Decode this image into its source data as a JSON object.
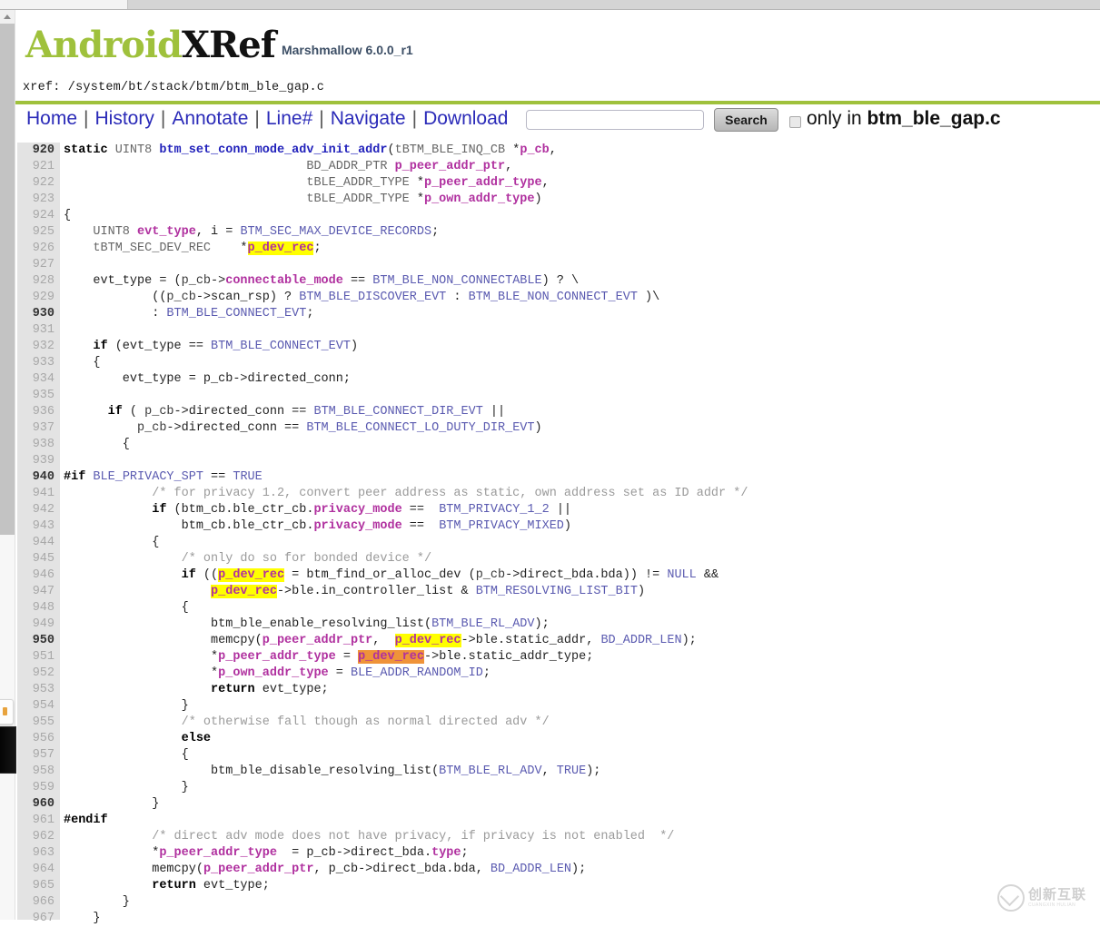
{
  "browser": {
    "tab_label": ""
  },
  "header": {
    "logo_android": "Android",
    "logo_xref": "XRef",
    "version": "Marshmallow 6.0.0_r1",
    "xref_path": "xref: /system/bt/stack/btm/btm_ble_gap.c"
  },
  "nav": {
    "links": [
      "Home",
      "History",
      "Annotate",
      "Line#",
      "Navigate",
      "Download"
    ],
    "separator": "|",
    "search_value": "",
    "search_placeholder": "",
    "search_button": "Search",
    "only_in_prefix": "only in ",
    "only_in_file": "btm_ble_gap.c",
    "only_in_checked": false
  },
  "colors": {
    "brand_green": "#9fc13c",
    "link_blue": "#2a2ab8",
    "gutter_bg": "#e3e3e3",
    "highlight_yellow": "#ffff00",
    "highlight_orange": "#ef9339",
    "var_magenta": "#b0309f",
    "fn_blue": "#2222bb",
    "const_blue": "#5a5ab0",
    "comment_gray": "#9a9a9a"
  },
  "watermark": {
    "cn": "创新互联",
    "en": "CUANGXIN HULIAN"
  },
  "code": {
    "first_line": 920,
    "last_line": 967,
    "lines": [
      {
        "n": 920,
        "html": "<span class=\"kw\">static</span> <span class=\"typ\">UINT8</span> <span class=\"fn\">btm_set_conn_mode_adv_init_addr</span>(<span class=\"typ\">tBTM_BLE_INQ_CB</span> *<span class=\"var\">p_cb</span>,"
      },
      {
        "n": 921,
        "html": "                                 <span class=\"typ\">BD_ADDR_PTR</span> <span class=\"var\">p_peer_addr_ptr</span>,"
      },
      {
        "n": 922,
        "html": "                                 <span class=\"typ\">tBLE_ADDR_TYPE</span> *<span class=\"var\">p_peer_addr_type</span>,"
      },
      {
        "n": 923,
        "html": "                                 <span class=\"typ\">tBLE_ADDR_TYPE</span> *<span class=\"var\">p_own_addr_type</span>)"
      },
      {
        "n": 924,
        "html": "{"
      },
      {
        "n": 925,
        "html": "    <span class=\"typ\">UINT8</span> <span class=\"var\">evt_type</span>, i = <span class=\"cnst\">BTM_SEC_MAX_DEVICE_RECORDS</span>;"
      },
      {
        "n": 926,
        "html": "    <span class=\"typ\">tBTM_SEC_DEV_REC</span>    *<span class=\"hl\"><span class=\"var\">p_dev_rec</span></span>;"
      },
      {
        "n": 927,
        "html": ""
      },
      {
        "n": 928,
        "html": "    evt_type = (<span class=\"plain\">p_cb</span>-&gt;<span class=\"var\">connectable_mode</span> == <span class=\"cnst\">BTM_BLE_NON_CONNECTABLE</span>) ? \\"
      },
      {
        "n": 929,
        "html": "            ((<span class=\"plain\">p_cb</span>-&gt;scan_rsp) ? <span class=\"cnst\">BTM_BLE_DISCOVER_EVT</span> : <span class=\"cnst\">BTM_BLE_NON_CONNECT_EVT</span> )\\"
      },
      {
        "n": 930,
        "html": "            : <span class=\"cnst\">BTM_BLE_CONNECT_EVT</span>;"
      },
      {
        "n": 931,
        "html": ""
      },
      {
        "n": 932,
        "html": "    <span class=\"kw\">if</span> (evt_type == <span class=\"cnst\">BTM_BLE_CONNECT_EVT</span>)"
      },
      {
        "n": 933,
        "html": "    {"
      },
      {
        "n": 934,
        "html": "        evt_type = p_cb-&gt;directed_conn;"
      },
      {
        "n": 935,
        "html": ""
      },
      {
        "n": 936,
        "html": "      <span class=\"kw\">if</span> ( <span class=\"plain\">p_cb</span>-&gt;directed_conn == <span class=\"cnst\">BTM_BLE_CONNECT_DIR_EVT</span> ||"
      },
      {
        "n": 937,
        "html": "          <span class=\"plain\">p_cb</span>-&gt;directed_conn == <span class=\"cnst\">BTM_BLE_CONNECT_LO_DUTY_DIR_EVT</span>)"
      },
      {
        "n": 938,
        "html": "        {"
      },
      {
        "n": 939,
        "html": ""
      },
      {
        "n": 940,
        "html": "<span class=\"pp\">#if</span> <span class=\"cnst\">BLE_PRIVACY_SPT</span> == <span class=\"cnst\">TRUE</span>"
      },
      {
        "n": 941,
        "html": "            <span class=\"cmt\">/* for privacy 1.2, convert peer address as static, own address set as ID addr */</span>"
      },
      {
        "n": 942,
        "html": "            <span class=\"kw\">if</span> (btm_cb.ble_ctr_cb.<span class=\"var\">privacy_mode</span> ==  <span class=\"cnst\">BTM_PRIVACY_1_2</span> ||"
      },
      {
        "n": 943,
        "html": "                btm_cb.ble_ctr_cb.<span class=\"var\">privacy_mode</span> ==  <span class=\"cnst\">BTM_PRIVACY_MIXED</span>)"
      },
      {
        "n": 944,
        "html": "            {"
      },
      {
        "n": 945,
        "html": "                <span class=\"cmt\">/* only do so for bonded device */</span>"
      },
      {
        "n": 946,
        "html": "                <span class=\"kw\">if</span> ((<span class=\"hl\"><span class=\"var\">p_dev_rec</span></span> = btm_find_or_alloc_dev (<span class=\"plain\">p_cb</span>-&gt;direct_bda.bda)) != <span class=\"cnst\">NULL</span> &amp;&amp;"
      },
      {
        "n": 947,
        "html": "                    <span class=\"hl\"><span class=\"var\">p_dev_rec</span></span>-&gt;ble.in_controller_list &amp; <span class=\"cnst\">BTM_RESOLVING_LIST_BIT</span>)"
      },
      {
        "n": 948,
        "html": "                {"
      },
      {
        "n": 949,
        "html": "                    btm_ble_enable_resolving_list(<span class=\"cnst\">BTM_BLE_RL_ADV</span>);"
      },
      {
        "n": 950,
        "html": "                    memcpy(<span class=\"var\">p_peer_addr_ptr</span>,  <span class=\"hl\"><span class=\"var\">p_dev_rec</span></span>-&gt;ble.static_addr, <span class=\"cnst\">BD_ADDR_LEN</span>);"
      },
      {
        "n": 951,
        "html": "                    *<span class=\"var\">p_peer_addr_type</span> = <span class=\"hl2\"><span class=\"var\">p_dev_rec</span></span>-&gt;ble.static_addr_type;"
      },
      {
        "n": 952,
        "html": "                    *<span class=\"var\">p_own_addr_type</span> = <span class=\"cnst\">BLE_ADDR_RANDOM_ID</span>;"
      },
      {
        "n": 953,
        "html": "                    <span class=\"kw\">return</span> evt_type;"
      },
      {
        "n": 954,
        "html": "                }"
      },
      {
        "n": 955,
        "html": "                <span class=\"cmt\">/* otherwise fall though as normal directed adv */</span>"
      },
      {
        "n": 956,
        "html": "                <span class=\"kw\">else</span>"
      },
      {
        "n": 957,
        "html": "                {"
      },
      {
        "n": 958,
        "html": "                    btm_ble_disable_resolving_list(<span class=\"cnst\">BTM_BLE_RL_ADV</span>, <span class=\"cnst\">TRUE</span>);"
      },
      {
        "n": 959,
        "html": "                }"
      },
      {
        "n": 960,
        "html": "            }"
      },
      {
        "n": 961,
        "html": "<span class=\"pp\">#endif</span>"
      },
      {
        "n": 962,
        "html": "            <span class=\"cmt\">/* direct adv mode does not have privacy, if privacy is not enabled  */</span>"
      },
      {
        "n": 963,
        "html": "            *<span class=\"var\">p_peer_addr_type</span>  = p_cb-&gt;direct_bda.<span class=\"var\">type</span>;"
      },
      {
        "n": 964,
        "html": "            memcpy(<span class=\"var\">p_peer_addr_ptr</span>, p_cb-&gt;direct_bda.bda, <span class=\"cnst\">BD_ADDR_LEN</span>);"
      },
      {
        "n": 965,
        "html": "            <span class=\"kw\">return</span> evt_type;"
      },
      {
        "n": 966,
        "html": "        }"
      },
      {
        "n": 967,
        "html": "    }"
      }
    ]
  }
}
